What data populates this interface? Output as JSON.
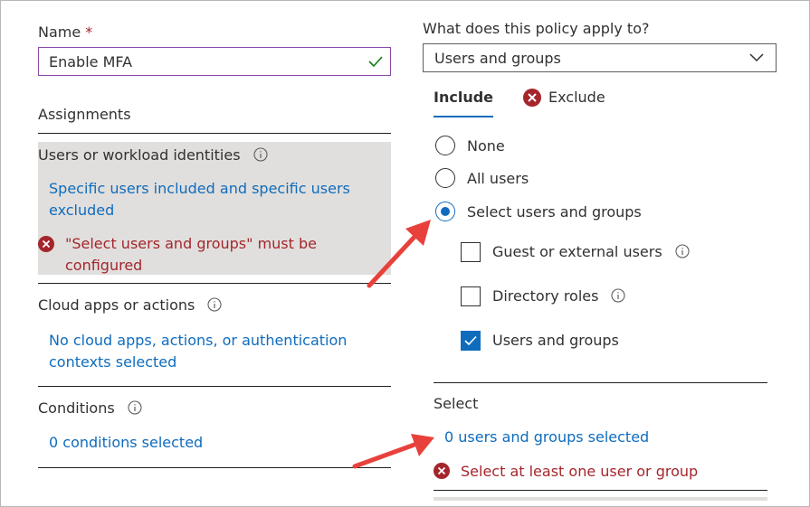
{
  "name_field": {
    "label": "Name",
    "required_mark": "*",
    "value": "Enable MFA"
  },
  "assignments": {
    "heading": "Assignments",
    "users": {
      "label": "Users or workload identities",
      "summary": "Specific users included and specific users excluded",
      "error": "\"Select users and groups\" must be configured"
    },
    "cloud_apps": {
      "label": "Cloud apps or actions",
      "summary": "No cloud apps, actions, or authentication contexts selected"
    },
    "conditions": {
      "label": "Conditions",
      "summary": "0 conditions selected"
    }
  },
  "policy": {
    "question": "What does this policy apply to?",
    "dropdown_value": "Users and groups",
    "tabs": {
      "include": "Include",
      "exclude": "Exclude"
    },
    "radios": [
      "None",
      "All users",
      "Select users and groups"
    ],
    "selected_radio": "Select users and groups",
    "checkboxes": [
      {
        "label": "Guest or external users",
        "checked": false
      },
      {
        "label": "Directory roles",
        "checked": false
      },
      {
        "label": "Users and groups",
        "checked": true
      }
    ],
    "select_label": "Select",
    "select_link": "0 users and groups selected",
    "select_error": "Select at least one user or group"
  },
  "colors": {
    "link": "#0f6cbd",
    "error": "#a4262c",
    "success": "#107c10",
    "accent": "#0f6cbd",
    "highlight": "#e1dfdd",
    "annotation": "#e8413c",
    "input_border": "#8a4aa9"
  }
}
